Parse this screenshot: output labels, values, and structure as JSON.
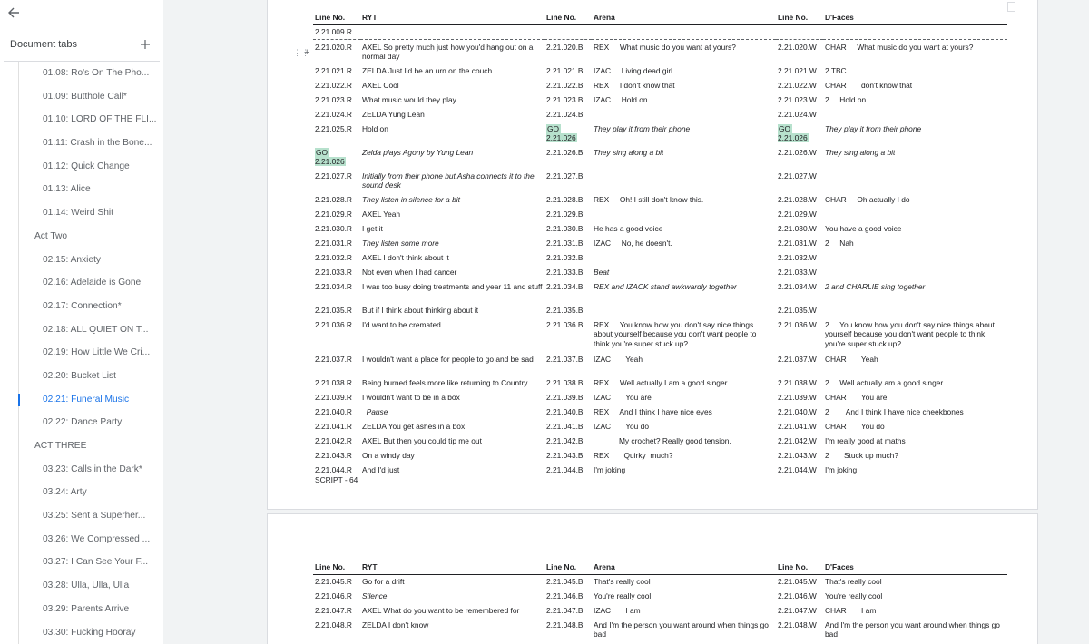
{
  "panel": {
    "title": "Document tabs",
    "tabs": [
      {
        "label": "01.08: Ro's On The Pho..."
      },
      {
        "label": "01.09: Butthole Call*"
      },
      {
        "label": "01.10: LORD OF THE FLI..."
      },
      {
        "label": "01.11: Crash in the Bone..."
      },
      {
        "label": "01.12: Quick Change"
      },
      {
        "label": "01.13: Alice"
      },
      {
        "label": "01.14: Weird Shit"
      },
      {
        "label": "Act Two",
        "section": true
      },
      {
        "label": "02.15: Anxiety"
      },
      {
        "label": "02.16: Adelaide is Gone"
      },
      {
        "label": "02.17: Connection*"
      },
      {
        "label": "02.18: ALL QUIET ON T..."
      },
      {
        "label": "02.19: How Little We Cri..."
      },
      {
        "label": "02.20: Bucket List"
      },
      {
        "label": "02.21: Funeral Music",
        "active": true
      },
      {
        "label": "02.22: Dance Party"
      },
      {
        "label": "ACT THREE",
        "section": true
      },
      {
        "label": "03.23: Calls in the Dark*"
      },
      {
        "label": "03.24: Arty"
      },
      {
        "label": "03.25: Sent a Superher..."
      },
      {
        "label": "03.26: We Compressed ..."
      },
      {
        "label": "03.27: I Can See Your F..."
      },
      {
        "label": "03.28: Ulla, Ulla, Ulla"
      },
      {
        "label": "03.29: Parents Arrive"
      },
      {
        "label": "03.30: Fucking Hooray"
      }
    ]
  },
  "headers": [
    "Line No.",
    "RYT",
    "Line No.",
    "Arena",
    "Line No.",
    "D'Faces"
  ],
  "page1": {
    "footer": "SCRIPT - 64",
    "rows": [
      {
        "h": 1,
        "dotted": true,
        "cells": [
          {
            "t": "2.21.009.R"
          },
          {
            "t": ""
          },
          {
            "t": ""
          },
          {
            "t": ""
          },
          {
            "t": ""
          },
          {
            "t": ""
          }
        ]
      },
      {
        "h": 2,
        "cells": [
          {
            "t": "2.21.020.R"
          },
          {
            "t": "AXEL So pretty much just how you'd hang out on a normal day"
          },
          {
            "t": "2.21.020.B"
          },
          {
            "t": "REX     What music do you want at yours?"
          },
          {
            "t": "2.21.020.W"
          },
          {
            "t": "CHAR     What music do you want at yours?"
          }
        ]
      },
      {
        "h": 1,
        "cells": [
          {
            "t": "2.21.021.R"
          },
          {
            "t": "ZELDA Just I'd be an urn on the couch"
          },
          {
            "t": "2.21.021.B"
          },
          {
            "t": "IZAC     Living dead girl"
          },
          {
            "t": "2.21.021.W"
          },
          {
            "t": "2 TBC"
          }
        ]
      },
      {
        "h": 1,
        "cells": [
          {
            "t": "2.21.022.R"
          },
          {
            "t": "AXEL Cool"
          },
          {
            "t": "2.21.022.B"
          },
          {
            "t": "REX     I don't know that"
          },
          {
            "t": "2.21.022.W"
          },
          {
            "t": "CHAR     I don't know that"
          }
        ]
      },
      {
        "h": 1,
        "cells": [
          {
            "t": "2.21.023.R"
          },
          {
            "t": "What music would they play"
          },
          {
            "t": "2.21.023.B"
          },
          {
            "t": "IZAC     Hold on"
          },
          {
            "t": "2.21.023.W"
          },
          {
            "t": "2     Hold on"
          }
        ]
      },
      {
        "h": 1,
        "cells": [
          {
            "t": "2.21.024.R"
          },
          {
            "t": "ZELDA Yung Lean"
          },
          {
            "t": "2.21.024.B"
          },
          {
            "t": ""
          },
          {
            "t": "2.21.024.W"
          },
          {
            "t": ""
          }
        ]
      },
      {
        "h": 1,
        "cells": [
          {
            "t": "2.21.025.R"
          },
          {
            "t": "Hold on"
          },
          {
            "t": "GO 2.21.026",
            "hl": true
          },
          {
            "t": "They play it from their phone",
            "it": true
          },
          {
            "t": "GO 2.21.026",
            "hl": true
          },
          {
            "t": "They play it from their phone",
            "it": true
          }
        ]
      },
      {
        "h": 1,
        "cells": [
          {
            "t": "GO 2.21.026",
            "hl": true
          },
          {
            "t": "Zelda plays Agony by Yung Lean",
            "it": true
          },
          {
            "t": "2.21.026.B"
          },
          {
            "t": "They sing along a bit",
            "it": true
          },
          {
            "t": "2.21.026.W"
          },
          {
            "t": "They sing along a bit",
            "it": true
          }
        ]
      },
      {
        "h": 2,
        "cells": [
          {
            "t": "2.21.027.R"
          },
          {
            "t": "Initially from their phone but Asha connects it to the sound desk",
            "it": true
          },
          {
            "t": "2.21.027.B"
          },
          {
            "t": ""
          },
          {
            "t": "2.21.027.W"
          },
          {
            "t": ""
          }
        ]
      },
      {
        "h": 1,
        "cells": [
          {
            "t": "2.21.028.R"
          },
          {
            "t": "They listen in silence for a bit",
            "it": true
          },
          {
            "t": "2.21.028.B"
          },
          {
            "t": "REX     Oh! I still don't know this."
          },
          {
            "t": "2.21.028.W"
          },
          {
            "t": "CHAR     Oh actually I do"
          }
        ]
      },
      {
        "h": 1,
        "cells": [
          {
            "t": "2.21.029.R"
          },
          {
            "t": "AXEL Yeah"
          },
          {
            "t": "2.21.029.B"
          },
          {
            "t": ""
          },
          {
            "t": "2.21.029.W"
          },
          {
            "t": ""
          }
        ]
      },
      {
        "h": 1,
        "cells": [
          {
            "t": "2.21.030.R"
          },
          {
            "t": "I get it"
          },
          {
            "t": "2.21.030.B"
          },
          {
            "t": "He has a good voice"
          },
          {
            "t": "2.21.030.W"
          },
          {
            "t": "You have a good voice"
          }
        ]
      },
      {
        "h": 1,
        "cells": [
          {
            "t": "2.21.031.R"
          },
          {
            "t": "They listen some more",
            "it": true
          },
          {
            "t": "2.21.031.B"
          },
          {
            "t": "IZAC     No, he doesn't."
          },
          {
            "t": "2.21.031.W"
          },
          {
            "t": "2     Nah"
          }
        ]
      },
      {
        "h": 1,
        "cells": [
          {
            "t": "2.21.032.R"
          },
          {
            "t": "AXEL I don't think about it"
          },
          {
            "t": "2.21.032.B"
          },
          {
            "t": ""
          },
          {
            "t": "2.21.032.W"
          },
          {
            "t": ""
          }
        ]
      },
      {
        "h": 1,
        "cells": [
          {
            "t": "2.21.033.R"
          },
          {
            "t": "Not even when I had cancer"
          },
          {
            "t": "2.21.033.B"
          },
          {
            "t": "Beat",
            "it": true
          },
          {
            "t": "2.21.033.W"
          },
          {
            "t": ""
          }
        ]
      },
      {
        "h": 2,
        "cells": [
          {
            "t": "2.21.034.R"
          },
          {
            "t": "I was too busy doing treatments and year 11 and stuff"
          },
          {
            "t": "2.21.034.B"
          },
          {
            "t": "REX and IZACK stand awkwardly together",
            "it": true
          },
          {
            "t": "2.21.034.W"
          },
          {
            "t": "2 and CHARLIE sing together",
            "it": true
          }
        ]
      },
      {
        "h": 1,
        "cells": [
          {
            "t": "2.21.035.R"
          },
          {
            "t": "But if I think about thinking about it"
          },
          {
            "t": "2.21.035.B"
          },
          {
            "t": ""
          },
          {
            "t": "2.21.035.W"
          },
          {
            "t": ""
          }
        ]
      },
      {
        "h": 3,
        "cells": [
          {
            "t": "2.21.036.R"
          },
          {
            "t": "I'd want to be cremated"
          },
          {
            "t": "2.21.036.B"
          },
          {
            "t": "REX     You know how you don't say nice things about yourself because you don't want people to think you're super stuck up?"
          },
          {
            "t": "2.21.036.W"
          },
          {
            "t": "2     You know how you don't say nice things about yourself because you don't want people to think you're super stuck up?"
          }
        ]
      },
      {
        "h": 2,
        "cells": [
          {
            "t": "2.21.037.R"
          },
          {
            "t": "I wouldn't want a place for people to go and be sad"
          },
          {
            "t": "2.21.037.B"
          },
          {
            "t": "IZAC       Yeah"
          },
          {
            "t": "2.21.037.W"
          },
          {
            "t": "CHAR       Yeah"
          }
        ]
      },
      {
        "h": 1,
        "cells": [
          {
            "t": "2.21.038.R"
          },
          {
            "t": "Being burned feels more like returning to Country"
          },
          {
            "t": "2.21.038.B"
          },
          {
            "t": "REX     Well actually I am a good singer"
          },
          {
            "t": "2.21.038.W"
          },
          {
            "t": "2     Well actually am a good singer"
          }
        ]
      },
      {
        "h": 1,
        "cells": [
          {
            "t": "2.21.039.R"
          },
          {
            "t": "I wouldn't want to be in a box"
          },
          {
            "t": "2.21.039.B"
          },
          {
            "t": "IZAC       You are"
          },
          {
            "t": "2.21.039.W"
          },
          {
            "t": "CHAR       You are"
          }
        ]
      },
      {
        "h": 1,
        "cells": [
          {
            "t": "2.21.040.R"
          },
          {
            "t": "  Pause",
            "it": true
          },
          {
            "t": "2.21.040.B"
          },
          {
            "t": "REX     And I think I have nice eyes"
          },
          {
            "t": "2.21.040.W"
          },
          {
            "t": "2        And I think I have nice cheekbones"
          }
        ]
      },
      {
        "h": 1,
        "cells": [
          {
            "t": "2.21.041.R"
          },
          {
            "t": "ZELDA You get ashes in a box"
          },
          {
            "t": "2.21.041.B"
          },
          {
            "t": "IZAC       You do"
          },
          {
            "t": "2.21.041.W"
          },
          {
            "t": "CHAR       You do"
          }
        ]
      },
      {
        "h": 1,
        "cells": [
          {
            "t": "2.21.042.R"
          },
          {
            "t": "AXEL But then you could tip me out"
          },
          {
            "t": "2.21.042.B"
          },
          {
            "t": "            My crochet? Really good tension."
          },
          {
            "t": "2.21.042.W"
          },
          {
            "t": "I'm really good at maths"
          }
        ]
      },
      {
        "h": 1,
        "cells": [
          {
            "t": "2.21.043.R"
          },
          {
            "t": "On a windy day"
          },
          {
            "t": "2.21.043.B"
          },
          {
            "t": "REX       Quirky  much?"
          },
          {
            "t": "2.21.043.W"
          },
          {
            "t": "2       Stuck up much?"
          }
        ]
      },
      {
        "h": 1,
        "cells": [
          {
            "t": "2.21.044.R"
          },
          {
            "t": "And I'd just"
          },
          {
            "t": "2.21.044.B"
          },
          {
            "t": "I'm joking"
          },
          {
            "t": "2.21.044.W"
          },
          {
            "t": "I'm joking"
          }
        ]
      }
    ]
  },
  "page2": {
    "rows": [
      {
        "h": 1,
        "cells": [
          {
            "t": "2.21.045.R"
          },
          {
            "t": "Go for a drift"
          },
          {
            "t": "2.21.045.B"
          },
          {
            "t": "That's really cool"
          },
          {
            "t": "2.21.045.W"
          },
          {
            "t": "That's really cool"
          }
        ]
      },
      {
        "h": 1,
        "cells": [
          {
            "t": "2.21.046.R"
          },
          {
            "t": "Silence",
            "it": true
          },
          {
            "t": "2.21.046.B"
          },
          {
            "t": "You're really cool"
          },
          {
            "t": "2.21.046.W"
          },
          {
            "t": "You're really cool"
          }
        ]
      },
      {
        "h": 1,
        "cells": [
          {
            "t": "2.21.047.R"
          },
          {
            "t": "AXEL What do you want to be remembered for"
          },
          {
            "t": "2.21.047.B"
          },
          {
            "t": "IZAC       I am"
          },
          {
            "t": "2.21.047.W"
          },
          {
            "t": "CHAR       I am"
          }
        ]
      },
      {
        "h": 2,
        "cells": [
          {
            "t": "2.21.048.R"
          },
          {
            "t": "ZELDA I don't know"
          },
          {
            "t": "2.21.048.B"
          },
          {
            "t": "And I'm the person you want around when things go bad"
          },
          {
            "t": "2.21.048.W"
          },
          {
            "t": "And I'm the person you want around when things go bad"
          }
        ]
      }
    ]
  }
}
